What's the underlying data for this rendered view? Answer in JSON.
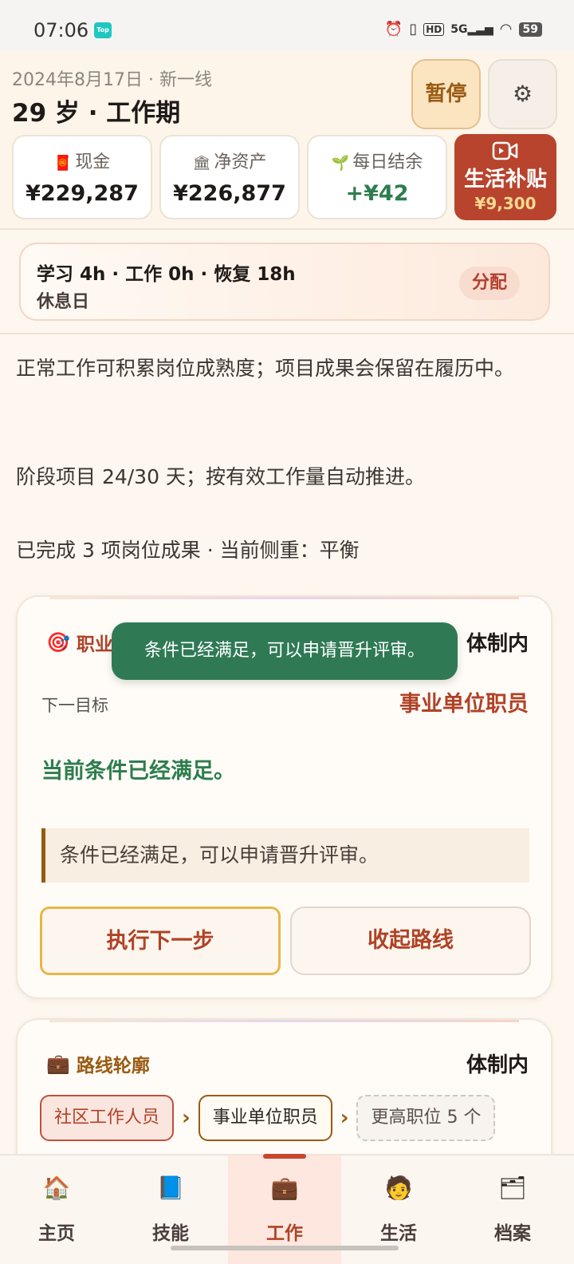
{
  "status_bar": {
    "time": "07:06",
    "app_badge": "Top",
    "battery": "59",
    "network": "5G",
    "hd": "HD"
  },
  "header": {
    "date_line": "2024年8月17日 · 新一线",
    "age_line": "29 岁 · 工作期",
    "pause_label": "暂停",
    "settings_icon": "⚙"
  },
  "stats": [
    {
      "icon": "red-envelope-icon",
      "label": "现金",
      "value": "¥229,287"
    },
    {
      "icon": "building-icon",
      "label": "净资产",
      "value": "¥226,877"
    },
    {
      "icon": "sprout-icon",
      "label": "每日结余",
      "value": "+¥42"
    }
  ],
  "subsidy": {
    "title": "生活补贴",
    "amount": "¥9,300"
  },
  "allocation": {
    "line1": "学习 4h · 工作 0h · 恢复 18h",
    "line2": "休息日",
    "button": "分配"
  },
  "paragraphs": {
    "p1": "正常工作可积累岗位成熟度；项目成果会保留在履历中。",
    "p2": "阶段项目 24/30 天；按有效工作量自动推进。",
    "p3": "已完成 3 项岗位成果 · 当前侧重：平衡"
  },
  "career_card": {
    "title": "职业下一步",
    "system": "体制内",
    "next_label": "下一目标",
    "next_value": "事业单位职员",
    "met_line": "当前条件已经满足。",
    "note": "条件已经满足，可以申请晋升评审。",
    "primary_button": "执行下一步",
    "secondary_button": "收起路线"
  },
  "toast": {
    "text": "条件已经满足，可以申请晋升评审。"
  },
  "route_card": {
    "title": "路线轮廓",
    "system": "体制内",
    "steps": [
      {
        "label": "社区工作人员",
        "state": "done"
      },
      {
        "label": "事业单位职员",
        "state": "current"
      },
      {
        "label": "更高职位 5 个",
        "state": "more"
      }
    ]
  },
  "tabs": [
    {
      "label": "主页",
      "icon": "house-icon"
    },
    {
      "label": "技能",
      "icon": "book-icon"
    },
    {
      "label": "工作",
      "icon": "briefcase-icon",
      "active": true
    },
    {
      "label": "生活",
      "icon": "person-icon"
    },
    {
      "label": "档案",
      "icon": "archive-icon"
    }
  ]
}
